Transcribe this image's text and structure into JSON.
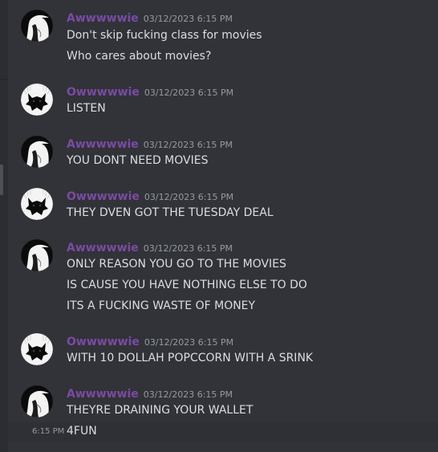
{
  "groups": [
    {
      "author": "Awwwwwie",
      "avatar": "dark-hair-girl-avatar",
      "time": "03/12/2023 6:15 PM",
      "lines": [
        "Don't skip fucking class for movies",
        "Who cares about movies?"
      ]
    },
    {
      "author": "Owwwwwie",
      "avatar": "black-cat-silhouette-avatar",
      "time": "03/12/2023 6:15 PM",
      "lines": [
        "LISTEN"
      ]
    },
    {
      "author": "Awwwwwie",
      "avatar": "dark-hair-girl-avatar",
      "time": "03/12/2023 6:15 PM",
      "lines": [
        "YOU DONT NEED MOVIES"
      ]
    },
    {
      "author": "Owwwwwie",
      "avatar": "black-cat-silhouette-avatar",
      "time": "03/12/2023 6:15 PM",
      "lines": [
        "THEY DVEN GOT THE TUESDAY DEAL"
      ]
    },
    {
      "author": "Awwwwwie",
      "avatar": "dark-hair-girl-avatar",
      "time": "03/12/2023 6:15 PM",
      "lines": [
        "ONLY REASON YOU GO TO THE MOVIES",
        "IS CAUSE YOU HAVE NOTHING ELSE TO DO",
        "ITS A FUCKING WASTE OF MONEY"
      ]
    },
    {
      "author": "Owwwwwie",
      "avatar": "black-cat-silhouette-avatar",
      "time": "03/12/2023 6:15 PM",
      "lines": [
        "WITH 10 DOLLAH POPCCORN WITH A SRINK"
      ]
    },
    {
      "author": "Awwwwwie",
      "avatar": "dark-hair-girl-avatar",
      "time": "03/12/2023 6:15 PM",
      "lines": [
        "THEYRE DRAINING YOUR WALLET",
        "4FUN"
      ],
      "hover_time": "6:15 PM"
    }
  ],
  "colors": {
    "background": "#313338",
    "username": "#7a4ba3",
    "message_text": "#dbdee1",
    "timestamp": "#949ba4",
    "hover_row": "#2e3035"
  }
}
